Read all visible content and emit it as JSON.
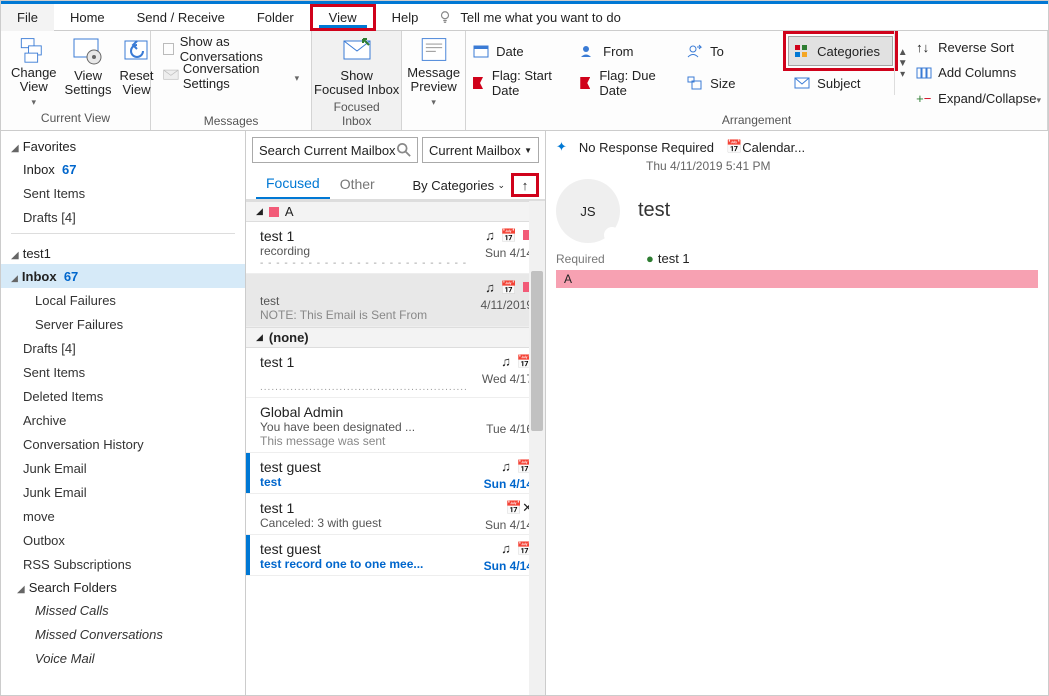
{
  "menu": {
    "file": "File",
    "home": "Home",
    "sendreceive": "Send / Receive",
    "folder": "Folder",
    "view": "View",
    "help": "Help",
    "tellme": "Tell me what you want to do"
  },
  "ribbon": {
    "change_view": "Change\nView",
    "view_settings": "View\nSettings",
    "reset_view": "Reset\nView",
    "show_conv": "Show as Conversations",
    "conv_settings": "Conversation Settings",
    "show_focused": "Show\nFocused Inbox",
    "msg_preview": "Message\nPreview",
    "date": "Date",
    "from": "From",
    "to": "To",
    "categories": "Categories",
    "flag_start": "Flag: Start Date",
    "flag_due": "Flag: Due Date",
    "size": "Size",
    "subject": "Subject",
    "reverse": "Reverse Sort",
    "add_cols": "Add Columns",
    "expand": "Expand/Collapse",
    "grp_currentview": "Current View",
    "grp_messages": "Messages",
    "grp_focused": "Focused Inbox",
    "grp_arrangement": "Arrangement"
  },
  "folder_pane": {
    "favorites": "Favorites",
    "fav_items": [
      {
        "label": "Inbox",
        "count": "67"
      },
      {
        "label": "Sent Items"
      },
      {
        "label": "Drafts [4]"
      }
    ],
    "account": "test1",
    "inbox": {
      "label": "Inbox",
      "count": "67"
    },
    "inbox_children": [
      "Local Failures",
      "Server Failures"
    ],
    "items": [
      "Drafts [4]",
      "Sent Items",
      "Deleted Items",
      "Archive",
      "Conversation History",
      "Junk Email",
      "Junk Email",
      "move",
      "Outbox",
      "RSS Subscriptions"
    ],
    "search_folders": "Search Folders",
    "search_children": [
      "Missed Calls",
      "Missed Conversations",
      "Voice Mail"
    ]
  },
  "msg_pane": {
    "search_placeholder": "Search Current Mailbox",
    "scope": "Current Mailbox",
    "tab_focused": "Focused",
    "tab_other": "Other",
    "sort": "By Categories",
    "group_a": "A",
    "group_none": "(none)",
    "msgs_a": [
      {
        "from": "test 1",
        "subject": "recording",
        "date": "Sun 4/14",
        "cat": true
      },
      {
        "from": "",
        "subject": "test",
        "preview": "NOTE: This Email is Sent From",
        "date": "4/11/2019",
        "cat": true,
        "sel": true
      }
    ],
    "msgs_none": [
      {
        "from": "test 1",
        "subject": "",
        "preview_dots": true,
        "date": "Wed 4/17"
      },
      {
        "from": "Global Admin",
        "subject": "You have been designated ...",
        "preview": "This message was sent",
        "date": "Tue 4/16"
      },
      {
        "from": "test guest",
        "subject": "test",
        "date": "Sun 4/14",
        "blue": true,
        "bar": true
      },
      {
        "from": "test 1",
        "subject": "Canceled: 3 with guest",
        "date": "Sun 4/14",
        "cancel": true
      },
      {
        "from": "test guest",
        "subject": "test record one to one mee...",
        "date": "Sun 4/14",
        "blue": true,
        "bar": true
      }
    ]
  },
  "read_pane": {
    "no_response": "No Response Required",
    "calendar": "Calendar...",
    "datetime": "Thu 4/11/2019 5:41 PM",
    "initials": "JS",
    "subject": "test",
    "required_label": "Required",
    "required_val": "test 1",
    "category": "A"
  }
}
